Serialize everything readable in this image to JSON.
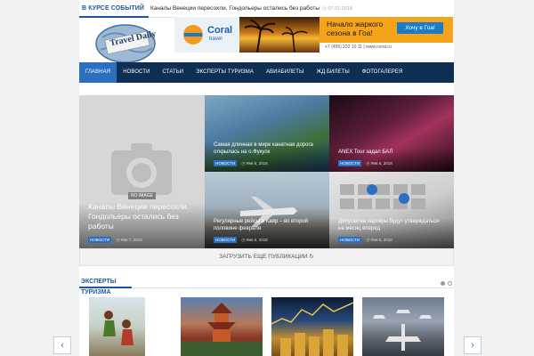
{
  "ticker": {
    "label": "В КУРСЕ СОБЫТИЙ",
    "headline": "Каналы Венеции пересохли. Гондольеры остались без работы",
    "date": "07.01.2018"
  },
  "logo": {
    "alt_text": "Travel Daily"
  },
  "banner": {
    "brand": "Coral",
    "brand_sub": "travel",
    "title": "Начало жаркого сезона в Гоа!",
    "button": "Хочу в Гоа!",
    "contact": "+7 (495) 232 10 11  |  www.coral.ru"
  },
  "nav": {
    "items": [
      {
        "label": "ГЛАВНАЯ",
        "active": true
      },
      {
        "label": "НОВОСТИ",
        "active": false
      },
      {
        "label": "СТАТЬИ",
        "active": false
      },
      {
        "label": "ЭКСПЕРТЫ ТУРИЗМА",
        "active": false
      },
      {
        "label": "АВИАБИЛЕТЫ",
        "active": false
      },
      {
        "label": "ЖД БИЛЕТЫ",
        "active": false
      },
      {
        "label": "ФОТОГАЛЕРЕЯ",
        "active": false
      }
    ]
  },
  "grid": {
    "big": {
      "title": "Каналы Венеции пересохли. Гондольеры остались без работы",
      "tag": "НОВОСТИ",
      "date": "Янв 7, 2018",
      "noimage": "NO IMAGE"
    },
    "small": [
      {
        "title": "Самая длинная в мире канатная дорога открылась на о.Фукуок",
        "tag": "НОВОСТИ",
        "date": "Янв 6, 2018"
      },
      {
        "title": "ANEX Tour задал БАЛ",
        "tag": "НОВОСТИ",
        "date": "Янв 6, 2018"
      },
      {
        "title": "Регулярные рейсы в Каир – во второй половине февраля",
        "tag": "НОВОСТИ",
        "date": "Янв 5, 2018"
      },
      {
        "title": "Допуски на чартеры будут утверждаться на месяц вперед",
        "tag": "НОВОСТИ",
        "date": "Янв 5, 2018"
      }
    ]
  },
  "load_more": "ЗАГРУЗИТЬ ЕЩЕ ПУБЛИКАЦИИ",
  "experts": {
    "title": "ЭКСПЕРТЫ ТУРИЗМА"
  },
  "colors": {
    "accent": "#2a6fc0",
    "nav_bg": "#0e2f54",
    "banner_orange": "#f5a31a"
  }
}
